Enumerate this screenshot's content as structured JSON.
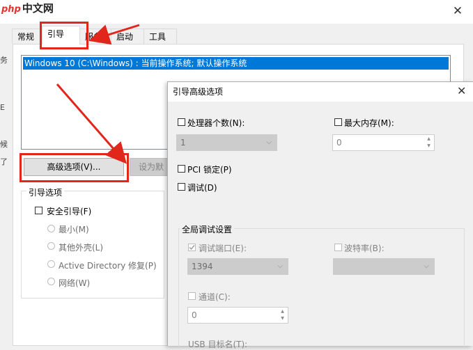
{
  "watermark": {
    "brand_php": "php",
    "brand_zh": "中文网"
  },
  "tabs": [
    {
      "label": "常规"
    },
    {
      "label": "引导"
    },
    {
      "label": "服务"
    },
    {
      "label": "启动"
    },
    {
      "label": "工具"
    }
  ],
  "os_list": {
    "items": [
      "Windows 10 (C:\\Windows) : 当前操作系统; 默认操作系统"
    ]
  },
  "buttons": {
    "advanced": "高级选项(V)...",
    "set_default": "设为默"
  },
  "boot_options": {
    "legend": "引导选项",
    "safe_boot": "安全引导(F)",
    "minimal": "最小(M)",
    "alternate_shell": "其他外壳(L)",
    "ad_repair": "Active Directory 修复(P)",
    "network": "网络(W)"
  },
  "left_edge_fragments": [
    "务",
    "E",
    "候",
    "了"
  ],
  "dialog": {
    "title": "引导高级选项",
    "num_processors_label": "处理器个数(N):",
    "num_processors_value": "1",
    "max_memory_label": "最大内存(M):",
    "max_memory_value": "0",
    "pci_lock_label": "PCI 锁定(P)",
    "debug_label": "调试(D)",
    "global_debug": {
      "legend": "全局调试设置",
      "debug_port_label": "调试端口(E):",
      "debug_port_value": "1394",
      "baud_rate_label": "波特率(B):",
      "baud_rate_value": "",
      "channel_label": "通道(C):",
      "channel_value": "0",
      "usb_target_label": "USB 目标名(T):"
    }
  },
  "colors": {
    "accent": "#0078d7",
    "annotation_red": "#e1261c",
    "brand_php": "#e8322b"
  }
}
